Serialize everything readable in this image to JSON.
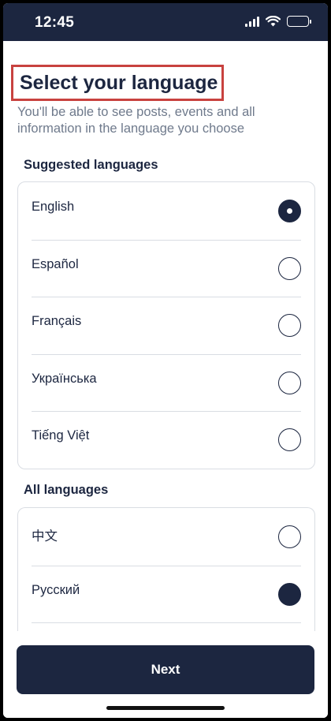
{
  "status_bar": {
    "time": "12:45"
  },
  "header": {
    "title": "Select your language",
    "subtitle": "You'll be able to see posts, events and all information in the language you choose"
  },
  "suggested": {
    "label": "Suggested languages",
    "items": [
      {
        "label": "English",
        "selected": true
      },
      {
        "label": "Español",
        "selected": false
      },
      {
        "label": "Français",
        "selected": false
      },
      {
        "label": "Українська",
        "selected": false
      },
      {
        "label": "Tiếng Việt",
        "selected": false
      }
    ]
  },
  "all": {
    "label": "All languages",
    "items": [
      {
        "label": "中文",
        "selected": false
      },
      {
        "label": "Русский",
        "selected": true
      }
    ]
  },
  "footer": {
    "next_label": "Next"
  },
  "colors": {
    "primary": "#1c2640",
    "highlight": "#c8423f",
    "muted": "#6f7a8c",
    "divider": "#d9dde3"
  }
}
